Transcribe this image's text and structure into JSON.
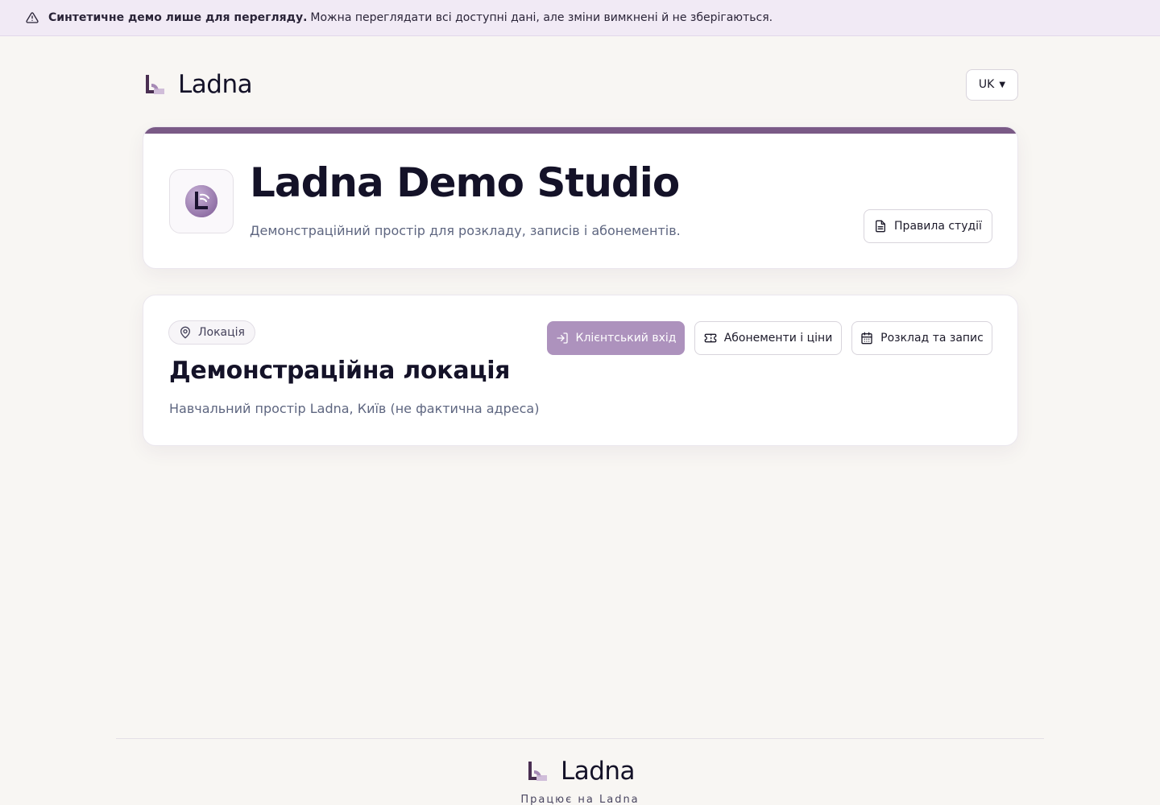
{
  "banner": {
    "icon": "warning-icon",
    "strong": "Синтетичне демо лише для перегляду.",
    "text": "Можна переглядати всі доступні дані, але зміни вимкнені й не зберігаються."
  },
  "header": {
    "brand": "Ladna",
    "language": "UK"
  },
  "studio": {
    "title": "Ladna Demo Studio",
    "subtitle": "Демонстраційний простір для розкладу, записів і абонементів.",
    "rules_label": "Правила студії"
  },
  "location": {
    "chip": "Локація",
    "title": "Демонстраційна локація",
    "address": "Навчальний простір Ladna, Київ (не фактична адреса)",
    "actions": {
      "login": "Клієнтський вхід",
      "subscriptions": "Абонементи і ціни",
      "schedule": "Розклад та запис"
    }
  },
  "footer": {
    "brand": "Ladna",
    "powered": "Працює на Ladna"
  },
  "colors": {
    "accent": "#7a5a86",
    "primary_button": "#ad92bd",
    "banner_bg": "#f1eaf5",
    "page_bg": "#f8f6f3"
  }
}
